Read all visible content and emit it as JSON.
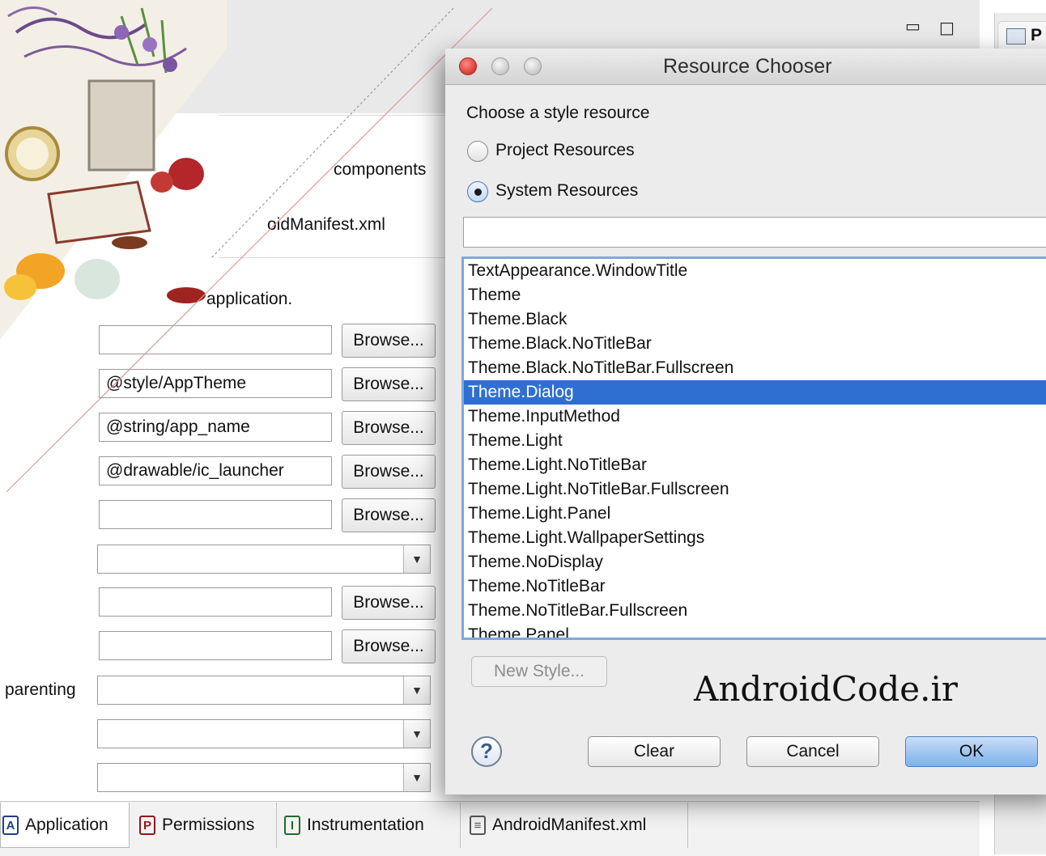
{
  "editor": {
    "partial_labels": {
      "components": "components",
      "manifest": "oidManifest.xml",
      "application": "application.",
      "parenting": "parenting"
    },
    "fields": [
      {
        "value": ""
      },
      {
        "value": "@style/AppTheme"
      },
      {
        "value": "@string/app_name"
      },
      {
        "value": "@drawable/ic_launcher"
      },
      {
        "value": ""
      },
      {
        "value": ""
      },
      {
        "value": ""
      }
    ],
    "browse_label": "Browse...",
    "window_controls": {
      "minimize": "▭",
      "maximize": "□"
    },
    "side_tab_label": "P",
    "bottom_tabs": [
      {
        "icon": "A",
        "label": "Application"
      },
      {
        "icon": "P",
        "label": "Permissions"
      },
      {
        "icon": "I",
        "label": "Instrumentation"
      },
      {
        "icon": "≡",
        "label": "AndroidManifest.xml"
      }
    ]
  },
  "dialog": {
    "title": "Resource Chooser",
    "prompt": "Choose a style resource",
    "radio_project": "Project Resources",
    "radio_system": "System Resources",
    "selected_radio": "System Resources",
    "filter_value": "",
    "items": [
      "TextAppearance.WindowTitle",
      "Theme",
      "Theme.Black",
      "Theme.Black.NoTitleBar",
      "Theme.Black.NoTitleBar.Fullscreen",
      "Theme.Dialog",
      "Theme.InputMethod",
      "Theme.Light",
      "Theme.Light.NoTitleBar",
      "Theme.Light.NoTitleBar.Fullscreen",
      "Theme.Light.Panel",
      "Theme.Light.WallpaperSettings",
      "Theme.NoDisplay",
      "Theme.NoTitleBar",
      "Theme.NoTitleBar.Fullscreen",
      "Theme.Panel"
    ],
    "selected_item": "Theme.Dialog",
    "new_style_label": "New Style...",
    "watermark": "AndroidCode.ir",
    "help_label": "?",
    "clear_label": "Clear",
    "cancel_label": "Cancel",
    "ok_label": "OK"
  },
  "colors": {
    "selection": "#2f6fd1",
    "ok_button": "#7eb1ec",
    "close_light": "#e0443e",
    "min_light": "#d6d6d6",
    "max_light": "#d6d6d6"
  }
}
